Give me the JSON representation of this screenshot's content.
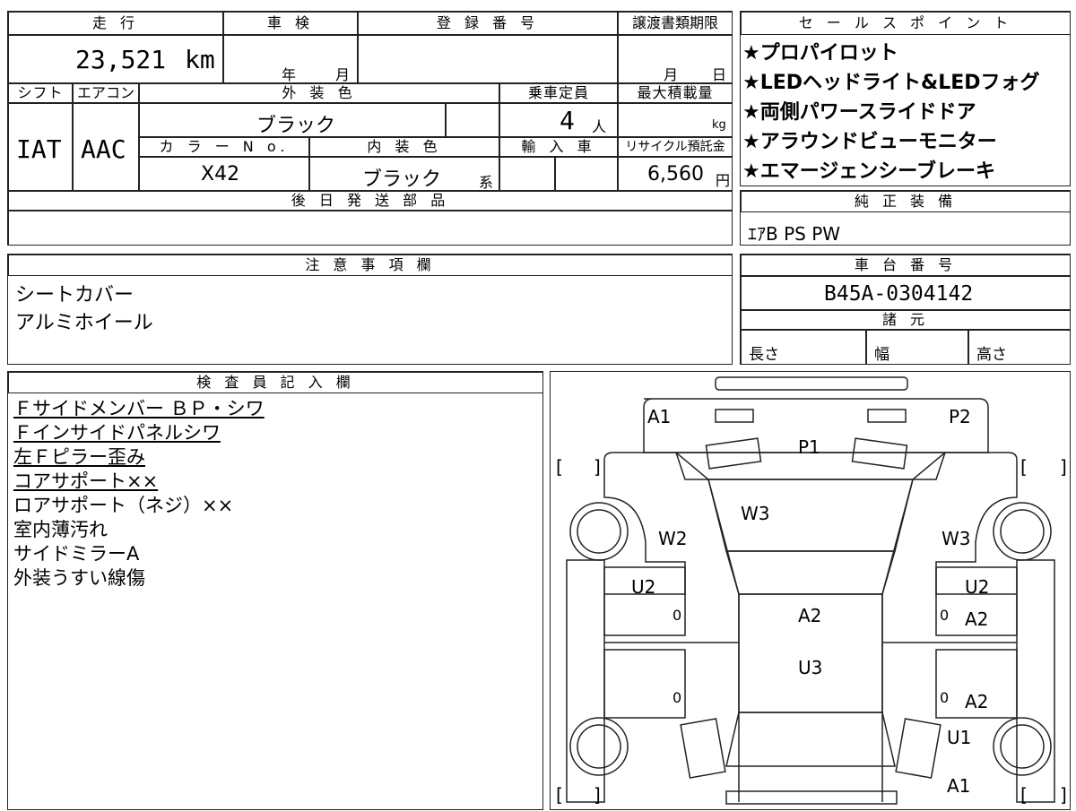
{
  "headers": {
    "mileage": "走 行",
    "inspection": "車 検",
    "registration": "登 録 番 号",
    "transfer_deadline": "譲渡書類期限",
    "shift": "シフト",
    "aircon": "エアコン",
    "exterior_color": "外 装 色",
    "capacity": "乗車定員",
    "max_load": "最大積載量",
    "color_no": "カ ラ ー N o.",
    "interior_color": "内 装 色",
    "import": "輸 入 車",
    "recycle": "リサイクル預託金",
    "later_parts": "後 日 発 送 部 品",
    "sales_points": "セ ー ル ス ポ イ ン ト",
    "genuine_equipment": "純 正 装 備",
    "notes": "注 意 事 項 欄",
    "chassis_no": "車 台 番 号",
    "specs": "諸 元",
    "inspector": "検 査 員 記 入 欄"
  },
  "values": {
    "mileage": "23,521",
    "mileage_unit": "km",
    "inspection_year": "年",
    "inspection_month": "月",
    "transfer_month": "月",
    "transfer_day": "日",
    "shift": "IAT",
    "aircon": "AAC",
    "exterior_color": "ブラック",
    "capacity": "4",
    "capacity_unit": "人",
    "max_load_unit": "kg",
    "color_no": "X42",
    "interior_color": "ブラック",
    "interior_suffix": "系",
    "recycle": "6,560",
    "recycle_unit": "円",
    "genuine_equipment": "ｴｱB PS PW",
    "chassis_no": "B45A-0304142",
    "spec_length": "長さ",
    "spec_width": "幅",
    "spec_height": "高さ"
  },
  "sales_points": [
    "★プロパイロット",
    "★LEDヘッドライト&LEDフォグ",
    "★両側パワースライドドア",
    "★アラウンドビューモニター",
    "★エマージェンシーブレーキ"
  ],
  "notes": [
    "シートカバー",
    "アルミホイール"
  ],
  "inspector_notes": [
    {
      "text": "Ｆサイドメンバー ＢＰ・シワ",
      "underline": true
    },
    {
      "text": "Ｆインサイドパネルシワ",
      "underline": true
    },
    {
      "text": "左Ｆピラー歪み",
      "underline": true
    },
    {
      "text": "コアサポート××",
      "underline": true
    },
    {
      "text": "ロアサポート（ネジ）××",
      "underline": false
    },
    {
      "text": "室内薄汚れ",
      "underline": false
    },
    {
      "text": "サイドミラーA",
      "underline": false
    },
    {
      "text": "外装うすい線傷",
      "underline": false
    }
  ],
  "diagram_labels": {
    "a1_top": "A1",
    "p2": "P2",
    "p1": "P1",
    "w3_center": "W3",
    "w2": "W2",
    "w3_right": "W3",
    "u2_left": "U2",
    "u2_right": "U2",
    "a2_center": "A2",
    "a2_right_upper": "A2",
    "u3": "U3",
    "a2_right_lower": "A2",
    "u1": "U1",
    "a1_bottom": "A1",
    "zero": "0",
    "bracket_open": "[",
    "bracket_close": "]"
  }
}
